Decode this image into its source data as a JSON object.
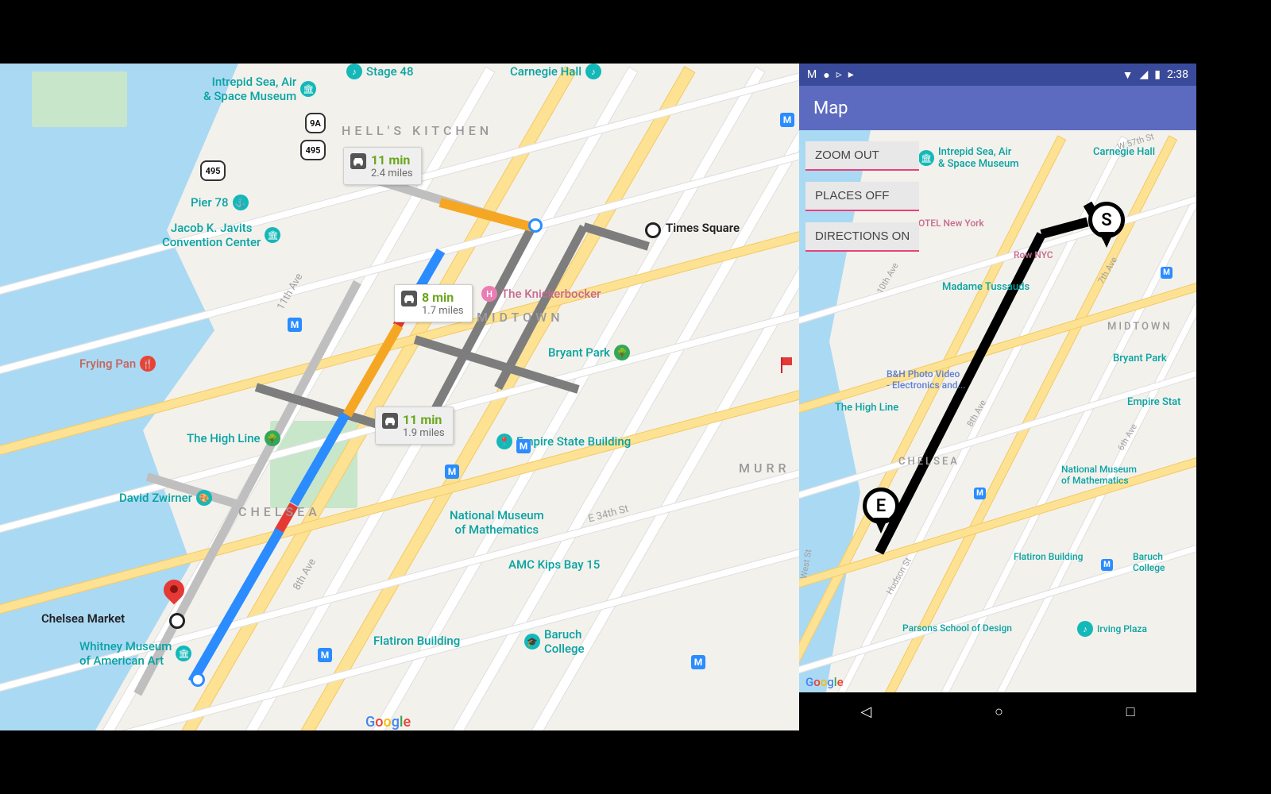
{
  "left": {
    "origin_label": "Times Square",
    "dest_label": "Chelsea Market",
    "districts": {
      "hells_kitchen": "HELL'S KITCHEN",
      "midtown": "MIDTOWN",
      "chelsea": "CHELSEA",
      "murray": "MURR"
    },
    "routes": [
      {
        "id": "a",
        "time": "11 min",
        "dist": "2.4 miles",
        "gray": true
      },
      {
        "id": "b",
        "time": "8 min",
        "dist": "1.7 miles",
        "gray": false
      },
      {
        "id": "c",
        "time": "11 min",
        "dist": "1.9 miles",
        "gray": true
      }
    ],
    "poi": {
      "intrepid": "Intrepid Sea, Air\n& Space Museum",
      "stage48": "Stage 48",
      "carnegie": "Carnegie Hall",
      "pier78": "Pier 78",
      "javits": "Jacob K. Javits\nConvention Center",
      "fryingpan": "Frying Pan",
      "highline": "The High Line",
      "zwirner": "David Zwirner",
      "whitney": "Whitney Museum\nof American Art",
      "knick": "The Knickerbocker",
      "bryant": "Bryant Park",
      "empire": "Empire State Building",
      "natmath": "National Museum\nof Mathematics",
      "amc": "AMC Kips Bay 15",
      "flatiron": "Flatiron Building",
      "baruch": "Baruch\nCollege",
      "e34": "E 34th St"
    },
    "hwy": {
      "a": "495",
      "b": "495",
      "c": "9A"
    },
    "avenues": {
      "eleventh": "11th Ave",
      "eighth": "8th Ave"
    },
    "google": "Google"
  },
  "right": {
    "status_time": "2:38",
    "appbar": "Map",
    "buttons": [
      "ZOOM OUT",
      "PLACES OFF",
      "DIRECTIONS ON"
    ],
    "start": "S",
    "end": "E",
    "poi": {
      "intrepid": "Intrepid Sea, Air\n& Space Museum",
      "carnegie": "Carnegie Hall",
      "otel": "OTEL New York",
      "row": "Row NYC",
      "tussauds": "Madame Tussauds",
      "midtown": "MIDTOWN",
      "bryant": "Bryant Park",
      "bh": "B&H Photo Video\n- Electronics and...",
      "empire": "Empire Stat",
      "highline": "The High Line",
      "chelsea": "CHELSEA",
      "natmath": "National Museum\nof Mathematics",
      "flatiron": "Flatiron Building",
      "baruch": "Baruch\nCollege",
      "parsons": "Parsons School of Design",
      "irving": "Irving Plaza",
      "hudson": "Hudson St",
      "west": "West St",
      "w57": "W 57th St"
    },
    "avenues": {
      "tenth": "10th Ave",
      "eighth": "8th Ave",
      "seventh": "7th Ave",
      "sixth": "6th Ave"
    },
    "google": "Google"
  }
}
